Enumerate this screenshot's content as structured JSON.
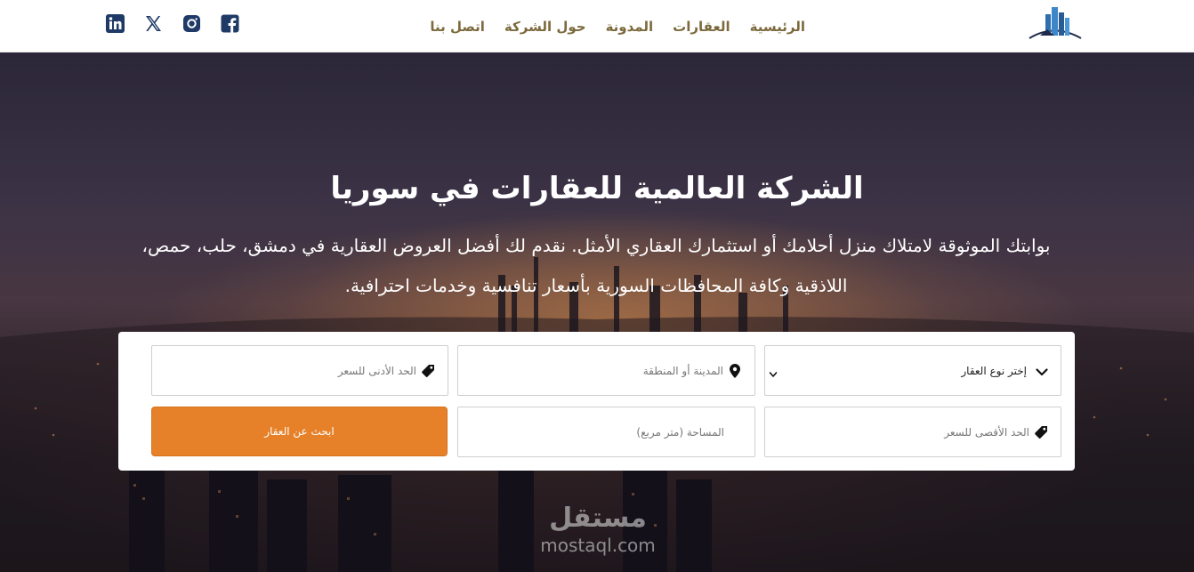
{
  "nav": {
    "links": [
      "الرئيسية",
      "العقارات",
      "المدونة",
      "حول الشركة",
      "اتصل بنا"
    ],
    "socials": [
      "linkedin-icon",
      "x-twitter-icon",
      "instagram-icon",
      "facebook-icon"
    ],
    "logo_icon": "building-logo-icon"
  },
  "hero": {
    "title": "الشركة العالمية للعقارات في سوريا",
    "subtitle": "بوابتك الموثوقة لامتلاك منزل أحلامك أو استثمارك العقاري الأمثل. نقدم لك أفضل العروض العقارية في دمشق، حلب، حمص، اللاذقية وكافة المحافظات السورية بأسعار تنافسية وخدمات احترافية."
  },
  "search": {
    "property_type": "إختر نوع العقار",
    "location_placeholder": "المدينة أو المنطقة",
    "min_price_placeholder": "الحد الأدنى للسعر",
    "max_price_placeholder": "الحد الأقصى للسعر",
    "area_placeholder": "المساحة (متر مربع)",
    "button_label": "ابحث عن العقار"
  },
  "watermark": {
    "arabic": "مستقل",
    "latin": "mostaql.com"
  },
  "colors": {
    "accent": "#e6812a",
    "nav_text": "#7c6a3d",
    "social": "#1f3a66"
  }
}
